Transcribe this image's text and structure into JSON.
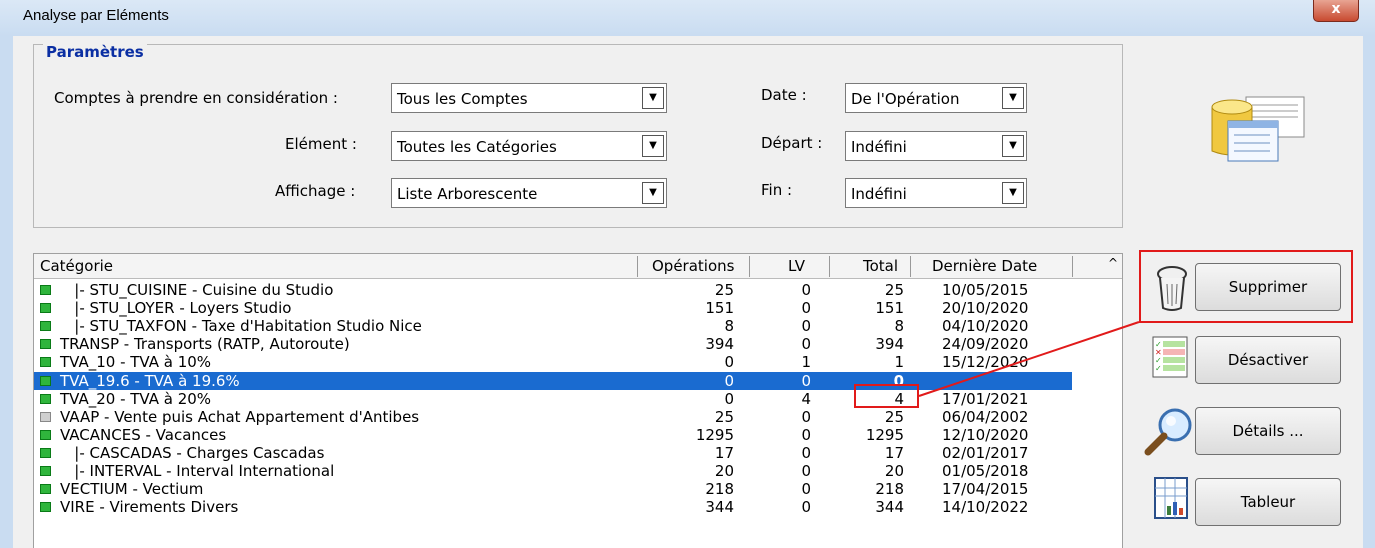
{
  "window": {
    "title": "Analyse par Eléments",
    "close_label": "x"
  },
  "params": {
    "legend": "Paramètres",
    "comptes_label": "Comptes à prendre en considération :",
    "comptes_value": "Tous les Comptes",
    "element_label": "Elément :",
    "element_value": "Toutes les Catégories",
    "affichage_label": "Affichage :",
    "affichage_value": "Liste Arborescente",
    "date_label": "Date :",
    "date_value": "De l'Opération",
    "depart_label": "Départ :",
    "depart_value": "Indéfini",
    "fin_label": "Fin :",
    "fin_value": "Indéfini"
  },
  "grid": {
    "headers": {
      "categorie": "Catégorie",
      "operations": "Opérations",
      "lv": "LV",
      "total": "Total",
      "date": "Dernière Date"
    },
    "rows": [
      {
        "cat": "   |- STU_CUISINE - Cuisine du Studio",
        "ops": "25",
        "lv": "0",
        "total": "25",
        "date": "10/05/2015"
      },
      {
        "cat": "   |- STU_LOYER - Loyers Studio",
        "ops": "151",
        "lv": "0",
        "total": "151",
        "date": "20/10/2020"
      },
      {
        "cat": "   |- STU_TAXFON - Taxe d'Habitation Studio Nice",
        "ops": "8",
        "lv": "0",
        "total": "8",
        "date": "04/10/2020"
      },
      {
        "cat": "TRANSP - Transports (RATP, Autoroute)",
        "ops": "394",
        "lv": "0",
        "total": "394",
        "date": "24/09/2020"
      },
      {
        "cat": "TVA_10 - TVA à 10%",
        "ops": "0",
        "lv": "1",
        "total": "1",
        "date": "15/12/2020"
      },
      {
        "cat": "TVA_19.6 - TVA à 19.6%",
        "ops": "0",
        "lv": "0",
        "total": "0",
        "date": ""
      },
      {
        "cat": "TVA_20 - TVA à 20%",
        "ops": "0",
        "lv": "4",
        "total": "4",
        "date": "17/01/2021"
      },
      {
        "cat": "VAAP - Vente puis Achat Appartement d'Antibes",
        "ops": "25",
        "lv": "0",
        "total": "25",
        "date": "06/04/2002"
      },
      {
        "cat": "VACANCES - Vacances",
        "ops": "1295",
        "lv": "0",
        "total": "1295",
        "date": "12/10/2020"
      },
      {
        "cat": "   |- CASCADAS - Charges Cascadas",
        "ops": "17",
        "lv": "0",
        "total": "17",
        "date": "02/01/2017"
      },
      {
        "cat": "   |- INTERVAL - Interval International",
        "ops": "20",
        "lv": "0",
        "total": "20",
        "date": "01/05/2018"
      },
      {
        "cat": "VECTIUM - Vectium",
        "ops": "218",
        "lv": "0",
        "total": "218",
        "date": "17/04/2015"
      },
      {
        "cat": "VIRE - Virements Divers",
        "ops": "344",
        "lv": "0",
        "total": "344",
        "date": "14/10/2022"
      }
    ]
  },
  "buttons": {
    "supprimer": "Supprimer",
    "desactiver": "Désactiver",
    "details": "Détails ...",
    "tableur": "Tableur"
  },
  "colors": {
    "highlight": "#1a6bd0",
    "annotation": "#e11a1a",
    "legend": "#0b2fa3"
  }
}
